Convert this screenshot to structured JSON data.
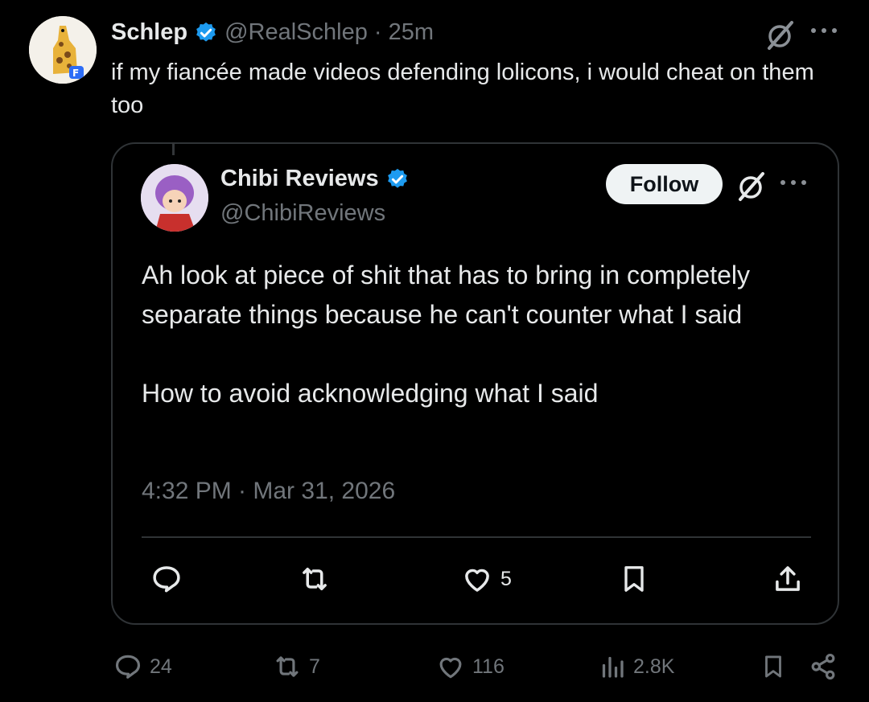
{
  "tweet": {
    "author_name": "Schlep",
    "handle": "@RealSchlep",
    "time": "· 25m",
    "text": "if my fiancée made videos defending lolicons, i would cheat on them too",
    "stats": {
      "replies": "24",
      "reposts": "7",
      "likes": "116",
      "views": "2.8K"
    }
  },
  "quote": {
    "author_name": "Chibi Reviews",
    "handle": "@ChibiReviews",
    "follow_label": "Follow",
    "paragraph1": "Ah look at piece of shit that has to bring in completely separate things because he can't counter what I said",
    "paragraph2": "How to avoid acknowledging what I said",
    "timestamp": "4:32 PM · Mar 31, 2026",
    "stats": {
      "likes": "5"
    }
  },
  "colors": {
    "background": "#000000",
    "text": "#e7e9ea",
    "muted": "#71767b",
    "verified": "#1d9bf0",
    "border": "#2f3336"
  },
  "icons": [
    "verified-badge-icon",
    "grok-icon",
    "more-icon",
    "reply-icon",
    "repost-icon",
    "like-icon",
    "bookmark-icon",
    "share-icon",
    "views-icon"
  ]
}
